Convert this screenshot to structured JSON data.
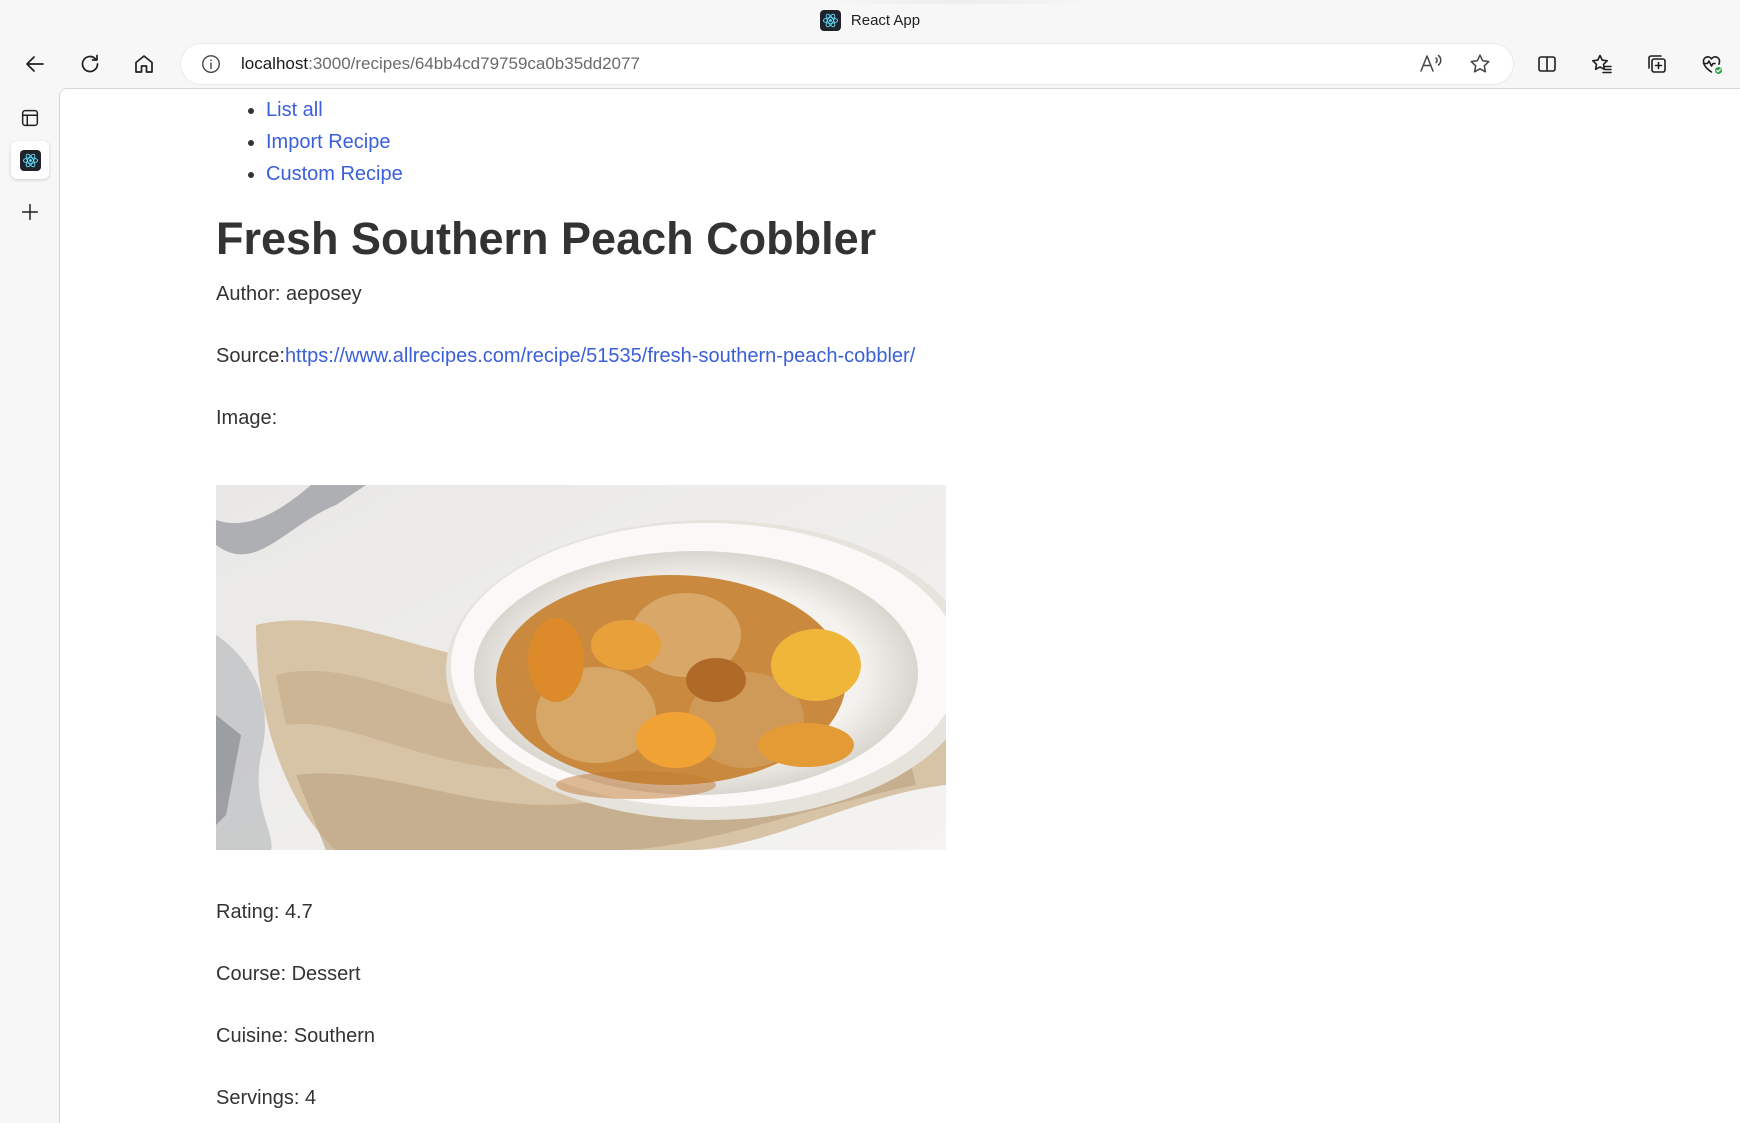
{
  "browser": {
    "tab_title": "React App",
    "url_host": "localhost",
    "url_path": ":3000/recipes/64bb4cd79759ca0b35dd2077"
  },
  "nav": {
    "items": [
      {
        "label": "List all"
      },
      {
        "label": "Import Recipe"
      },
      {
        "label": "Custom Recipe"
      }
    ]
  },
  "recipe": {
    "title": "Fresh Southern Peach Cobbler",
    "author_label": "Author: ",
    "author": "aeposey",
    "source_label": "Source:",
    "source_url": "https://www.allrecipes.com/recipe/51535/fresh-southern-peach-cobbler/",
    "image_label": "Image:",
    "rating_label": "Rating: ",
    "rating": "4.7",
    "course_label": "Course: ",
    "course": "Dessert",
    "cuisine_label": "Cuisine: ",
    "cuisine": "Southern",
    "servings_label": "Servings: ",
    "servings": "4"
  },
  "colors": {
    "link": "#3a5fd8",
    "text": "#333333",
    "chrome": "#f7f7f7"
  },
  "icons": {
    "back": "arrow-left-icon",
    "refresh": "refresh-icon",
    "home": "home-icon",
    "info": "info-icon",
    "read_aloud": "read-aloud-icon",
    "favorite": "star-icon",
    "split_screen": "split-screen-icon",
    "favorites": "favorites-icon",
    "collections": "collections-icon",
    "performance": "heartbeat-icon"
  }
}
